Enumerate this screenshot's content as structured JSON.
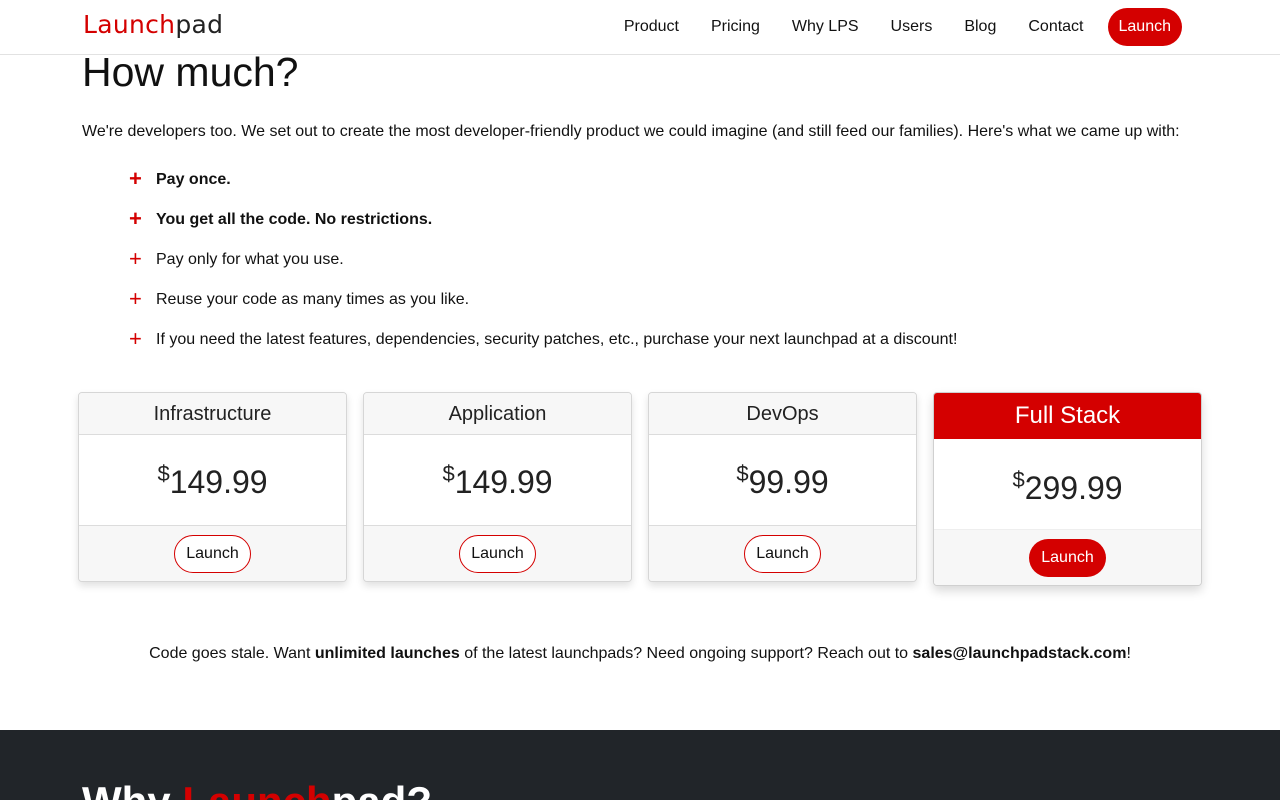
{
  "header": {
    "logo_accent": "Launch",
    "logo_rest": "pad",
    "nav": [
      {
        "label": "Product"
      },
      {
        "label": "Pricing"
      },
      {
        "label": "Why LPS"
      },
      {
        "label": "Users"
      },
      {
        "label": "Blog"
      },
      {
        "label": "Contact"
      }
    ],
    "launch_label": "Launch"
  },
  "pricing": {
    "title": "How much?",
    "intro": "We're developers too. We set out to create the most developer-friendly product we could imagine (and still feed our families). Here's what we came up with:",
    "features": [
      {
        "text": "Pay once.",
        "bold": true
      },
      {
        "text": "You get all the code. No restrictions.",
        "bold": true
      },
      {
        "text": "Pay only for what you use.",
        "bold": false
      },
      {
        "text": "Reuse your code as many times as you like.",
        "bold": false
      },
      {
        "text": "If you need the latest features, dependencies, security patches, etc., purchase your next launchpad at a discount!",
        "bold": false
      }
    ],
    "currency": "$",
    "plans": [
      {
        "name": "Infrastructure",
        "price": "149.99",
        "button": "Launch"
      },
      {
        "name": "Application",
        "price": "149.99",
        "button": "Launch"
      },
      {
        "name": "DevOps",
        "price": "99.99",
        "button": "Launch"
      },
      {
        "name": "Full Stack",
        "price": "299.99",
        "button": "Launch",
        "featured": true
      }
    ],
    "note": {
      "part1": "Code goes stale. Want ",
      "bold1": "unlimited launches",
      "part2": " of the latest launchpads? Need ongoing support? Reach out to ",
      "email": "sales@launchpadstack.com",
      "part3": "!"
    }
  },
  "why": {
    "title_start": "Why ",
    "title_accent": "Launch",
    "title_rest": "pad?"
  },
  "colors": {
    "accent": "#d40000",
    "dark_section": "#212529"
  }
}
